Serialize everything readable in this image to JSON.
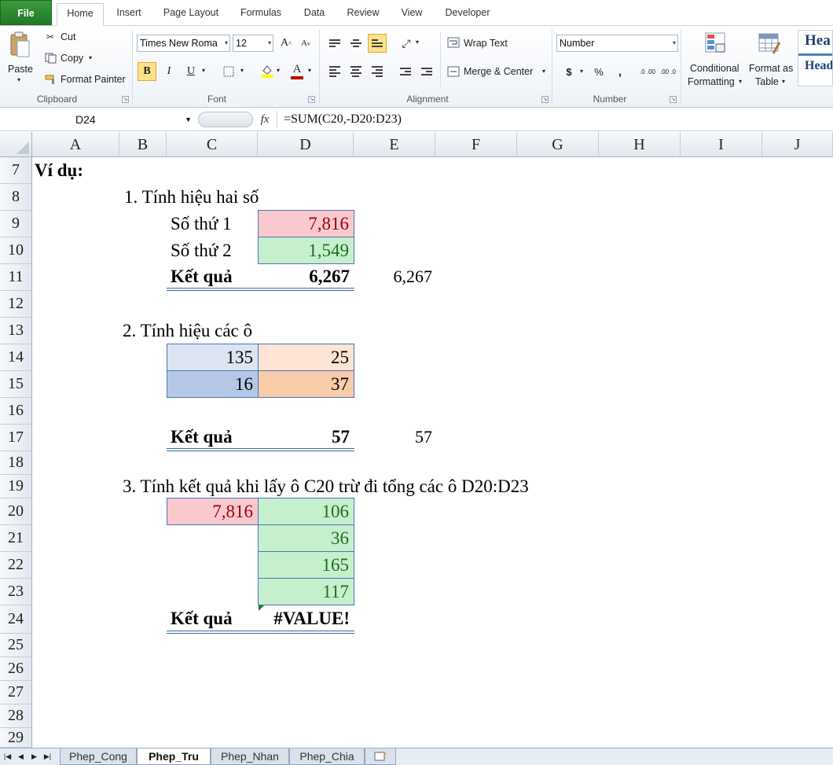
{
  "ribbon": {
    "tabs": [
      "File",
      "Home",
      "Insert",
      "Page Layout",
      "Formulas",
      "Data",
      "Review",
      "View",
      "Developer"
    ],
    "clipboard": {
      "paste": "Paste",
      "cut": "Cut",
      "copy": "Copy",
      "format_painter": "Format Painter",
      "label": "Clipboard"
    },
    "font": {
      "name": "Times New Roma",
      "size": "12",
      "label": "Font",
      "bold": "B",
      "italic": "I",
      "underline": "U",
      "grow": "A",
      "shrink": "A",
      "font_color": "A"
    },
    "alignment": {
      "wrap_text": "Wrap Text",
      "merge_center": "Merge & Center",
      "label": "Alignment"
    },
    "number": {
      "format": "Number",
      "currency": "$",
      "percent": "%",
      "comma": ",",
      "inc_decimal": ".0 .00",
      "dec_decimal": ".00 .0",
      "label": "Number"
    },
    "styles": {
      "conditional_formatting_1": "Conditional",
      "conditional_formatting_2": "Formatting",
      "format_table_1": "Format as",
      "format_table_2": "Table",
      "heading_1": "Hea",
      "heading_2": "Head"
    },
    "colors": {
      "accent_green": "#1f7a25",
      "highlight": "#fde28a",
      "font_red": "#c00000",
      "fill_yellow": "#ffff00"
    }
  },
  "formula_bar": {
    "name_box": "D24",
    "fx": "fx",
    "formula": "=SUM(C20,-D20:D23)"
  },
  "grid": {
    "columns": [
      "A",
      "B",
      "C",
      "D",
      "E",
      "F",
      "G",
      "H",
      "I",
      "J"
    ],
    "rows": [
      "7",
      "8",
      "9",
      "10",
      "11",
      "12",
      "13",
      "14",
      "15",
      "16",
      "17",
      "18",
      "19",
      "20",
      "21",
      "22",
      "23",
      "24",
      "25",
      "26",
      "27",
      "28",
      "29"
    ]
  },
  "sheet": {
    "example_title": "Ví dụ:",
    "sec1": {
      "title": "1. Tính hiệu hai số",
      "label1": "Số thứ 1",
      "value1": "7,816",
      "label2": "Số thứ 2",
      "value2": "1,549",
      "result_label": "Kết quả",
      "result_value": "6,267",
      "result_e": "6,267"
    },
    "sec2": {
      "title": "2. Tính hiệu các ô",
      "c14": "135",
      "d14": "25",
      "c15": "16",
      "d15": "37",
      "result_label": "Kết quả",
      "result_value": "57",
      "result_e": "57"
    },
    "sec3": {
      "title": "3. Tính kết quả khi lấy ô C20 trừ đi tổng các ô D20:D23",
      "c20": "7,816",
      "d20": "106",
      "d21": "36",
      "d22": "165",
      "d23": "117",
      "result_label": "Kết quả",
      "result_value": "#VALUE!"
    },
    "cell_colors": {
      "pink": "#f9c9cf",
      "green_fill": "#c6efce",
      "red_text": "#9c0006",
      "green_text": "#1e6e1e",
      "blue_light": "#dce4f2",
      "blue_mid": "#b4c7e7",
      "peach_light": "#fde4d4",
      "peach_mid": "#f8cba9"
    }
  },
  "sheet_tabs": [
    "Phep_Cong",
    "Phep_Tru",
    "Phep_Nhan",
    "Phep_Chia"
  ],
  "active_tab": "Phep_Tru"
}
